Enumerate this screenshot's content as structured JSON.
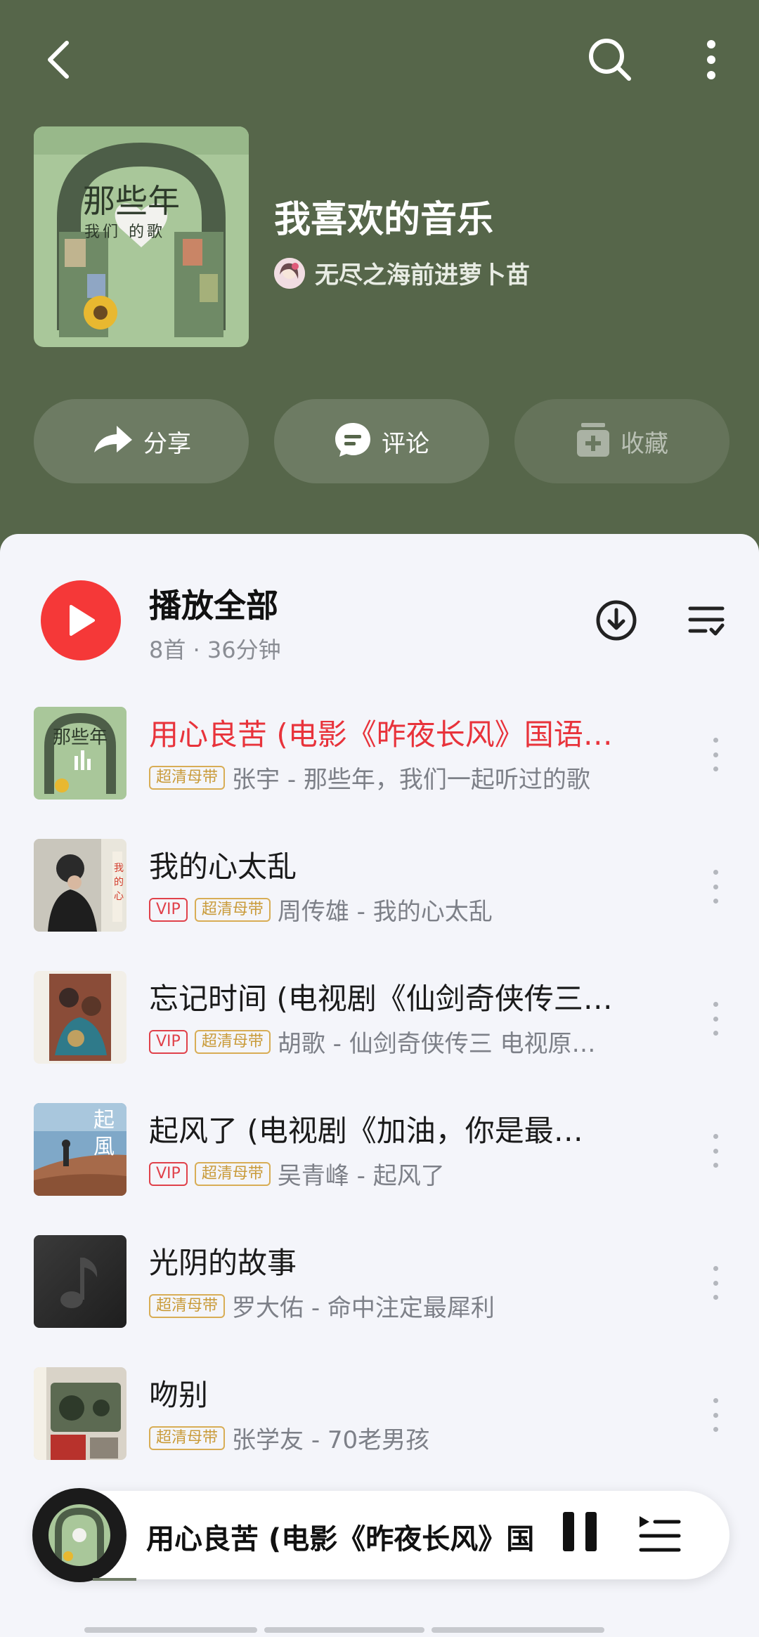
{
  "playlist": {
    "title": "我喜欢的音乐",
    "owner": "无尽之海前进萝卜苗",
    "cover_text": "那些年",
    "cover_sub": "我们 的歌"
  },
  "actions": {
    "share": "分享",
    "comment": "评论",
    "collect": "收藏"
  },
  "play_all": {
    "label": "播放全部",
    "meta": "8首 · 36分钟"
  },
  "tags": {
    "vip": "VIP",
    "hq": "超清母带"
  },
  "songs": [
    {
      "title": "用心良苦 (电影《昨夜长风》国语…",
      "artist": "张宇 - 那些年，我们一起听过的歌",
      "vip": false,
      "playing": true
    },
    {
      "title": "我的心太乱",
      "artist": "周传雄 - 我的心太乱",
      "vip": true,
      "playing": false
    },
    {
      "title": "忘记时间 (电视剧《仙剑奇侠传三…",
      "artist": "胡歌 - 仙剑奇侠传三 电视原…",
      "vip": true,
      "playing": false
    },
    {
      "title": "起风了 (电视剧《加油，你是最…",
      "artist": "吴青峰 - 起风了",
      "vip": true,
      "playing": false
    },
    {
      "title": "光阴的故事",
      "artist": "罗大佑 - 命中注定最犀利",
      "vip": false,
      "playing": false
    },
    {
      "title": "吻别",
      "artist": "张学友 - 70老男孩",
      "vip": false,
      "playing": false
    }
  ],
  "mini_player": {
    "title": "用心良苦 (电影《昨夜长风》国"
  },
  "colors": {
    "header_bg": "#56664a",
    "accent_red": "#f53838",
    "playing_text": "#e8333b",
    "hq_tag": "#c99b3a"
  },
  "icons": [
    "back-icon",
    "search-icon",
    "more-icon",
    "share-icon",
    "comment-icon",
    "collect-icon",
    "play-icon",
    "download-icon",
    "sort-icon",
    "pause-icon",
    "playlist-icon"
  ]
}
